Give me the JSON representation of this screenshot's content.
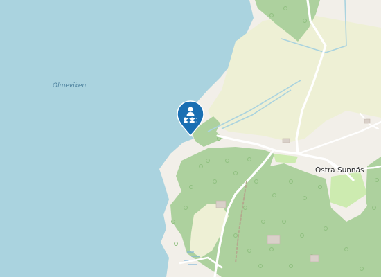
{
  "labels": {
    "water_body": "Olmeviken",
    "locality": "Östra Sunnäs"
  },
  "poi": {
    "icon": "swimming-icon",
    "color": "#1a6fb3"
  },
  "colors": {
    "water": "#aad3df",
    "land": "#f2efe9",
    "farmland": "#eef0d5",
    "forest": "#add19e",
    "meadow": "#cdebb0",
    "road": "#ffffff",
    "stream": "#aad3df"
  }
}
